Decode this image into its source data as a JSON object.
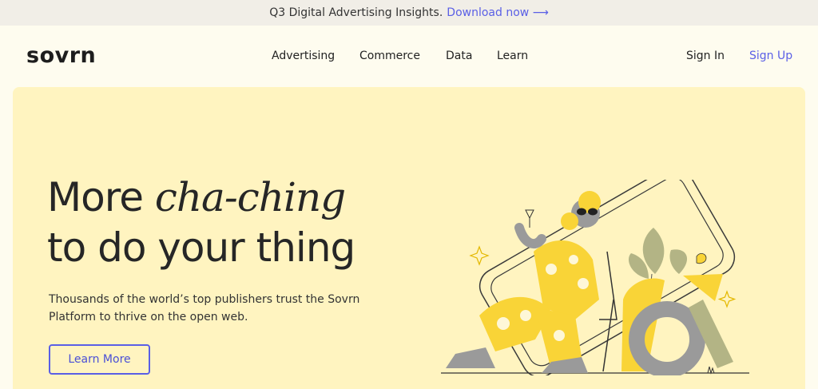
{
  "announcement": {
    "text": "Q3 Digital Advertising Insights.",
    "link_label": "Download now",
    "arrow": "⟶"
  },
  "header": {
    "logo": "sovrn",
    "nav": [
      {
        "label": "Advertising"
      },
      {
        "label": "Commerce"
      },
      {
        "label": "Data"
      },
      {
        "label": "Learn"
      }
    ],
    "sign_in": "Sign In",
    "sign_up": "Sign Up"
  },
  "hero": {
    "headline_prefix": "More ",
    "headline_emphasis": "cha-ching",
    "headline_line2": "to do your thing",
    "subtext": "Thousands of the world’s top publishers trust the Sovrn Platform to thrive on the open web.",
    "cta_label": "Learn More"
  },
  "colors": {
    "accent": "#5a5fe6",
    "hero_background": "#fff4c0",
    "page_background": "#fefcef",
    "illustration_yellow": "#f9d437",
    "illustration_gray": "#9a9a9a",
    "illustration_green": "#b3b485"
  }
}
